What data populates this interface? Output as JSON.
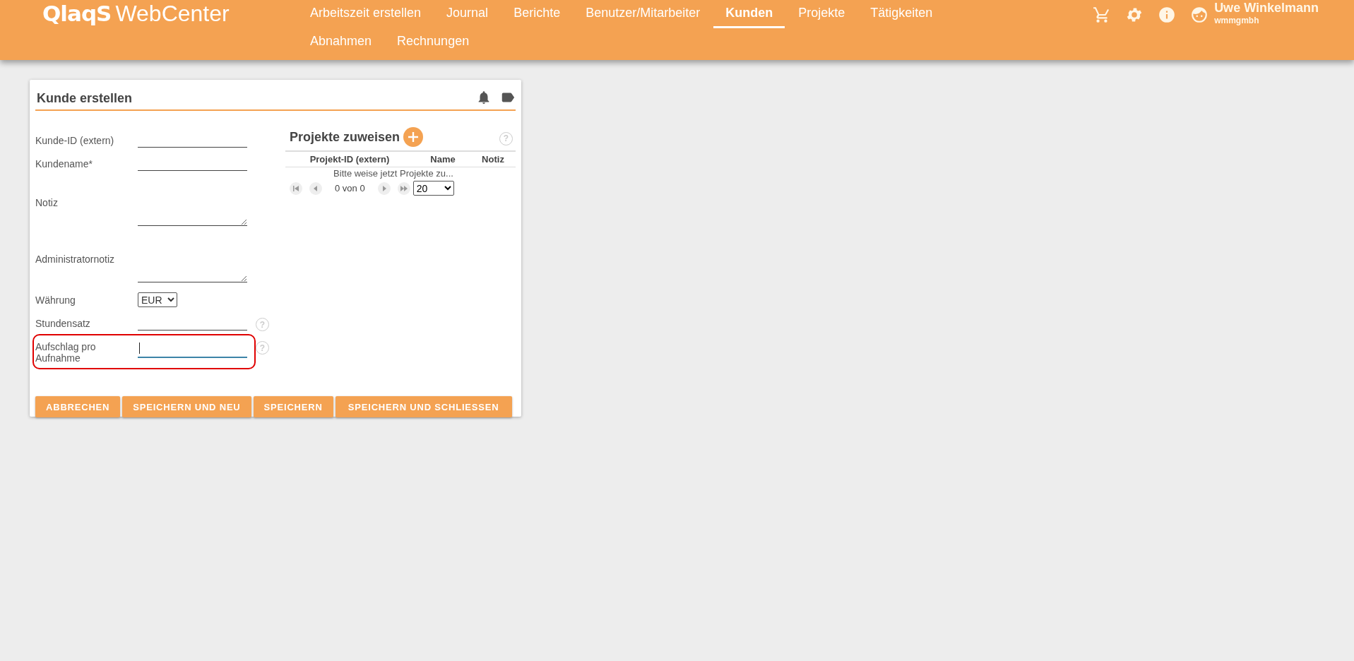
{
  "header": {
    "logo_brand": "QlaqS",
    "logo_product": "WebCenter",
    "nav": [
      {
        "label": "Arbeitszeit erstellen",
        "selected": false
      },
      {
        "label": "Journal",
        "selected": false
      },
      {
        "label": "Berichte",
        "selected": false
      },
      {
        "label": "Benutzer/Mitarbeiter",
        "selected": false
      },
      {
        "label": "Kunden",
        "selected": true
      },
      {
        "label": "Projekte",
        "selected": false
      },
      {
        "label": "Tätigkeiten",
        "selected": false
      },
      {
        "label": "Abnahmen",
        "selected": false
      },
      {
        "label": "Rechnungen",
        "selected": false
      }
    ],
    "user": {
      "name": "Uwe Winkelmann",
      "company": "wmmgmbh"
    }
  },
  "card": {
    "title": "Kunde erstellen",
    "fields": [
      {
        "kind": "text",
        "label": "Kunde-ID (extern)"
      },
      {
        "kind": "text",
        "label": "Kundename*"
      },
      {
        "kind": "textarea",
        "label": "Notiz"
      },
      {
        "kind": "textarea",
        "label": "Administratornotiz"
      },
      {
        "kind": "select",
        "label": "Währung",
        "value": "EUR"
      },
      {
        "kind": "text",
        "label": "Stundensatz",
        "help": "?"
      },
      {
        "kind": "text",
        "label": "Aufschlag pro Aufnahme",
        "help": "?",
        "focused": true,
        "highlighted": true
      }
    ],
    "projects": {
      "title": "Projekte zuweisen",
      "help": "?",
      "columns": [
        "Projekt-ID (extern)",
        "Name",
        "Notiz"
      ],
      "empty_message": "Bitte weise jetzt Projekte zu...",
      "page_info": "0 von 0",
      "page_size": "20"
    },
    "buttons": [
      "ABBRECHEN",
      "SPEICHERN UND NEU",
      "SPEICHERN",
      "SPEICHERN UND SCHLIESSEN"
    ]
  }
}
